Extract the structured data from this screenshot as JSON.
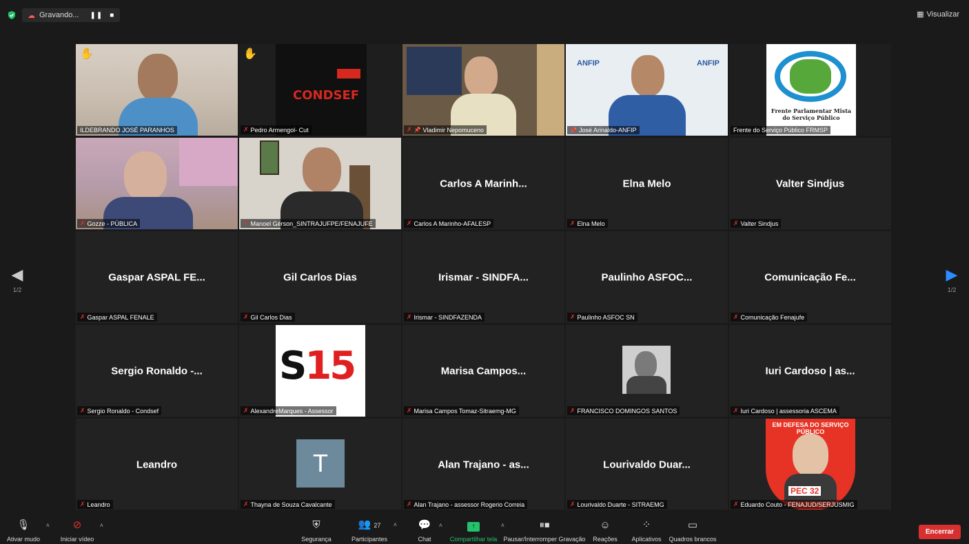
{
  "topbar": {
    "recording_label": "Gravando...",
    "view_label": "Visualizar"
  },
  "pagination": {
    "left_page": "1/2",
    "right_page": "1/2"
  },
  "tiles": [
    {
      "label": "ILDEBRANDO JOSÉ PARANHOS",
      "big": "",
      "muted": false,
      "pinned": false,
      "hand": true,
      "active": true
    },
    {
      "label": "Pedro Armengol- Cut",
      "big": "",
      "muted": true,
      "pinned": false,
      "hand": true,
      "logo_text": "CONDSEF"
    },
    {
      "label": "Vladimir Nepomuceno",
      "big": "",
      "muted": true,
      "pinned": true,
      "hand": false
    },
    {
      "label": "José Arinaldo-ANFIP",
      "big": "",
      "muted": false,
      "pinned": true,
      "hand": false,
      "logo_text": "ANFIP"
    },
    {
      "label": "Frente do Serviço Público FRMSP",
      "big": "",
      "muted": false,
      "pinned": false,
      "hand": false,
      "logo_text": "Frente Parlamentar Mista do Serviço Público"
    },
    {
      "label": "Gozze - PÚBLICA",
      "big": "",
      "muted": true,
      "pinned": false,
      "hand": false
    },
    {
      "label": "Manoel Gérson_SINTRAJUFPE/FENAJUFE",
      "big": "",
      "muted": true,
      "pinned": false,
      "hand": false
    },
    {
      "label": "Carlos A Marinho-AFALESP",
      "big": "Carlos A Marinh...",
      "muted": true,
      "pinned": false,
      "hand": false
    },
    {
      "label": "Elna Melo",
      "big": "Elna Melo",
      "muted": true,
      "pinned": false,
      "hand": false
    },
    {
      "label": "Valter Sindjus",
      "big": "Valter Sindjus",
      "muted": true,
      "pinned": false,
      "hand": false
    },
    {
      "label": "Gaspar ASPAL FENALE",
      "big": "Gaspar ASPAL FE...",
      "muted": true,
      "pinned": false,
      "hand": false
    },
    {
      "label": "Gil Carlos Dias",
      "big": "Gil Carlos Dias",
      "muted": true,
      "pinned": false,
      "hand": false
    },
    {
      "label": "Irismar - SINDFAZENDA",
      "big": "Irismar - SINDFA...",
      "muted": true,
      "pinned": false,
      "hand": false
    },
    {
      "label": "Paulinho ASFOC SN",
      "big": "Paulinho ASFOC...",
      "muted": true,
      "pinned": false,
      "hand": false
    },
    {
      "label": "Comunicação Fenajufe",
      "big": "Comunicação Fe...",
      "muted": true,
      "pinned": false,
      "hand": false
    },
    {
      "label": "Sergio Ronaldo - Condsef",
      "big": "Sergio Ronaldo -...",
      "muted": true,
      "pinned": false,
      "hand": false
    },
    {
      "label": "AlexandreMarques - Assessor",
      "big": "",
      "muted": true,
      "pinned": false,
      "hand": false,
      "logo_text": "S15"
    },
    {
      "label": "Marisa Campos Tomaz-Sitraemg-MG",
      "big": "Marisa Campos...",
      "muted": true,
      "pinned": false,
      "hand": false
    },
    {
      "label": "FRANCISCO DOMINGOS SANTOS",
      "big": "",
      "muted": true,
      "pinned": false,
      "hand": false
    },
    {
      "label": "Iuri Cardoso | assessoria ASCEMA",
      "big": "Iuri Cardoso | as...",
      "muted": true,
      "pinned": false,
      "hand": false
    },
    {
      "label": "Leandro",
      "big": "Leandro",
      "muted": true,
      "pinned": false,
      "hand": false
    },
    {
      "label": "Thayna de Souza Cavalcante",
      "big": "",
      "muted": true,
      "pinned": false,
      "hand": false,
      "avatar_letter": "T"
    },
    {
      "label": "Alan Trajano - assessor Rogerio Correia",
      "big": "Alan Trajano - as...",
      "muted": true,
      "pinned": false,
      "hand": false
    },
    {
      "label": "Lourivaldo Duarte - SITRAEMG",
      "big": "Lourivaldo Duar...",
      "muted": true,
      "pinned": false,
      "hand": false
    },
    {
      "label": "Eduardo Couto - FENAJUD/SERJUSMIG",
      "big": "",
      "muted": true,
      "pinned": false,
      "hand": false,
      "logo_text": "EM DEFESA DO SERVIÇO PÚBLICO",
      "logo_text2": "PEC 32"
    }
  ],
  "toolbar": {
    "mute": "Ativar mudo",
    "video": "Iniciar vídeo",
    "security": "Segurança",
    "participants": "Participantes",
    "participants_count": "27",
    "chat": "Chat",
    "share": "Compartilhar tela",
    "pause_rec": "Pausar/Interromper Gravação",
    "reactions": "Reações",
    "apps": "Aplicativos",
    "whiteboards": "Quadros brancos",
    "end": "Encerrar"
  }
}
